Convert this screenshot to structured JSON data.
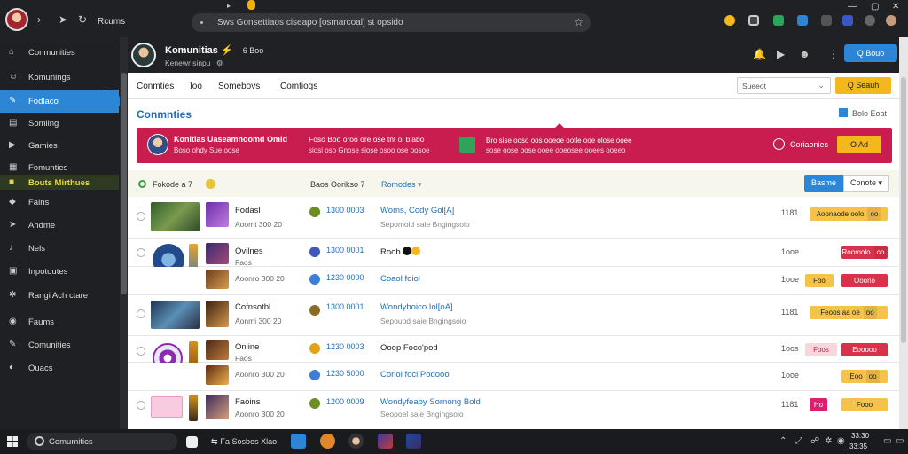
{
  "browser": {
    "app_name": "Rcums",
    "url": "Sws Gonsettiaos ciseapo [osmarcoal] st opsido"
  },
  "sidebar": {
    "items": [
      {
        "label": "Conmunities",
        "icon": "home-icon"
      },
      {
        "label": "Komunings",
        "icon": "users-icon"
      },
      {
        "label": "Fodlaco",
        "icon": "edit-icon",
        "state": "active"
      },
      {
        "label": "Somiing",
        "icon": "film-icon"
      },
      {
        "label": "Gamies",
        "icon": "play-icon"
      },
      {
        "label": "Fomunties",
        "icon": "grid-icon"
      },
      {
        "label": "Bouts Mirthues",
        "icon": "star-icon",
        "state": "highlight"
      },
      {
        "label": "Fains",
        "icon": "tag-icon"
      },
      {
        "label": "Ahdme",
        "icon": "send-icon"
      },
      {
        "label": "Nels",
        "icon": "bell-icon"
      },
      {
        "label": "Inpotoutes",
        "icon": "file-icon"
      },
      {
        "label": "Rangi Ach ctare",
        "icon": "gear-icon"
      },
      {
        "label": "Faums",
        "icon": "chat-icon"
      },
      {
        "label": "Comunities",
        "icon": "pin-icon"
      },
      {
        "label": "Ouacs",
        "icon": "help-icon"
      }
    ]
  },
  "header": {
    "name": "Komunitias",
    "status_icon": "⚡",
    "badge": "6 Boo",
    "subtitle": "Kenewr sinpu"
  },
  "tabs": [
    "Conmties",
    "Ioo",
    "Somebovs",
    "Comtiogs"
  ],
  "toolbar": {
    "filter_placeholder": "Sueeot",
    "search_label": "Q Seauh",
    "header_button": "Q Bouo"
  },
  "section": {
    "title": "Conmnties",
    "link": "Bolo Eoat"
  },
  "banner": {
    "t1": "Konitias Uaseamnoomd Omld",
    "t2": "Boso ohdy  Sue oose",
    "t3": "Foso Boo oroo ore ose tnt ol blabo",
    "t4": "siosi oso Gnose siose osoo ose oosoe",
    "t5": "Bro sise ooso oos ooeoe ootle ooe olose ooee",
    "t6": "sose  oose  bose ooee ooeosee ooees ooeeo",
    "info": "i",
    "label": "Coriaonies",
    "button": "O Ad"
  },
  "filter_row": {
    "label": "Fokode a 7",
    "mid": "Baos Oorikso 7",
    "right": "Romodes",
    "toggle_a": "Basme",
    "toggle_b": "Conote"
  },
  "rows": [
    {
      "name": "Fodasl",
      "sub": "Aoomt 300 20",
      "amount": "1300 0003",
      "title": "Woms, Cody Gol[A]",
      "title_sub": "Sepomold saie Bngingsoio",
      "count": "1181",
      "pill": "Aoonaode oolo",
      "pill_tail": "oo",
      "pill_style": "y"
    },
    {
      "name": "Ovilnes",
      "sub": "Faos",
      "amount": "1300 0001",
      "title": "Roob",
      "title_sub": "",
      "count": "1ooe",
      "pill": "Roomolo",
      "pill_tail": "oo",
      "pill_style": "r"
    },
    {
      "name": "",
      "sub": "Aoonro 300 20",
      "amount": "1230 0000",
      "title": "Coaol foiol",
      "title_sub": "",
      "count": "1ooe",
      "pill": "Foo",
      "pill_tail": "",
      "pill_style": "y",
      "pill2": "Ooono",
      "pill2_style": "r"
    },
    {
      "name": "Cofnsotbl",
      "sub": "Aonmi 300 20",
      "amount": "1300 0001",
      "title": "Wondyboico Iol[oA]",
      "title_sub": "Sepouod saie Bngingsoio",
      "count": "1181",
      "pill": "Feoos aa oe",
      "pill_tail": "oo",
      "pill_style": "y"
    },
    {
      "name": "Online",
      "sub": "Faos",
      "amount": "1230 0003",
      "title": "Ooop Foco'pod",
      "title_sub": "",
      "count": "1oos",
      "pill": "Foos",
      "pill_tail": "",
      "pill_style": "p",
      "pill2": "Eooooo",
      "pill2_style": "r"
    },
    {
      "name": "",
      "sub": "Aoonro 300 20",
      "amount": "1230 5000",
      "title": "Coriol foci Podooo",
      "title_sub": "",
      "count": "1ooe",
      "pill": "Eoo",
      "pill_tail": "oo",
      "pill_style": "y"
    },
    {
      "name": "Faoins",
      "sub": "Aoonro 300 20",
      "amount": "1200 0009",
      "title": "Wondyfeaby Sornong Bold",
      "title_sub": "Seopoel saie Bngingsoio",
      "count": "1181",
      "pill": "Ho",
      "pill_tail": "",
      "pill_style": "pk",
      "pill2": "Fooo",
      "pill2_style": "y"
    }
  ],
  "taskbar": {
    "search": "Comumitics",
    "label": "Fa Sosbos Xlao",
    "time": "33:30",
    "date": "33:35"
  },
  "colors": {
    "accent": "#2d86d5",
    "banner": "#c81d4e",
    "yellow": "#f3b81d",
    "red": "#d9314a"
  }
}
